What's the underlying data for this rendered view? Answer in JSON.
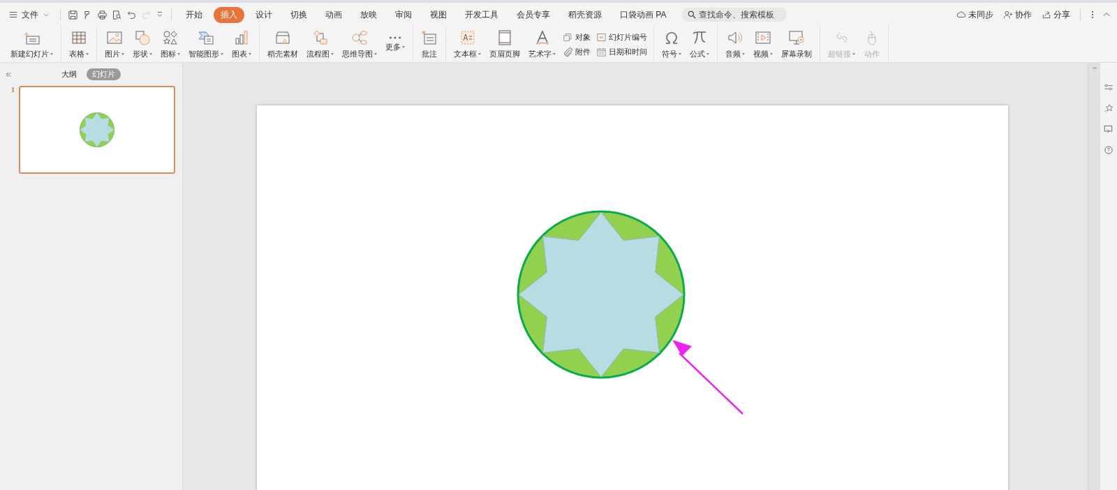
{
  "menu": {
    "file_label": "文件",
    "tabs": [
      {
        "label": "开始",
        "selected": false
      },
      {
        "label": "插入",
        "selected": true
      },
      {
        "label": "设计",
        "selected": false
      },
      {
        "label": "切换",
        "selected": false
      },
      {
        "label": "动画",
        "selected": false
      },
      {
        "label": "放映",
        "selected": false
      },
      {
        "label": "审阅",
        "selected": false
      },
      {
        "label": "视图",
        "selected": false
      },
      {
        "label": "开发工具",
        "selected": false
      },
      {
        "label": "会员专享",
        "selected": false
      },
      {
        "label": "稻壳资源",
        "selected": false
      },
      {
        "label": "口袋动画 PA",
        "selected": false
      }
    ],
    "search": {
      "placeholder": "查找命令、搜索模板"
    },
    "actions": [
      {
        "label": "未同步"
      },
      {
        "label": "协作"
      },
      {
        "label": "分享"
      }
    ]
  },
  "ribbon": {
    "groups": [
      {
        "items": [
          {
            "kind": "large",
            "label": "新建幻灯片",
            "dropdown": true,
            "disabled": false
          }
        ]
      },
      {
        "items": [
          {
            "kind": "large",
            "label": "表格",
            "dropdown": true,
            "disabled": false
          }
        ]
      },
      {
        "items": [
          {
            "kind": "large",
            "label": "图片",
            "dropdown": true,
            "disabled": false
          },
          {
            "kind": "large",
            "label": "形状",
            "dropdown": true,
            "disabled": false
          },
          {
            "kind": "large",
            "label": "图标",
            "dropdown": true,
            "disabled": false
          },
          {
            "kind": "large",
            "label": "智能图形",
            "dropdown": true,
            "disabled": false
          },
          {
            "kind": "large",
            "label": "图表",
            "dropdown": true,
            "disabled": false
          }
        ]
      },
      {
        "items": [
          {
            "kind": "large",
            "label": "稻壳素材",
            "dropdown": false,
            "disabled": false
          },
          {
            "kind": "large",
            "label": "流程图",
            "dropdown": true,
            "disabled": false
          },
          {
            "kind": "large",
            "label": "思维导图",
            "dropdown": true,
            "disabled": false
          },
          {
            "kind": "large",
            "label": "更多",
            "dropdown": true,
            "disabled": false
          }
        ]
      },
      {
        "items": [
          {
            "kind": "large",
            "label": "批注",
            "dropdown": false,
            "disabled": false
          }
        ]
      },
      {
        "items": [
          {
            "kind": "large",
            "label": "文本框",
            "dropdown": true,
            "disabled": false
          },
          {
            "kind": "large",
            "label": "页眉页脚",
            "dropdown": false,
            "disabled": false
          },
          {
            "kind": "large",
            "label": "艺术字",
            "dropdown": true,
            "disabled": false
          },
          {
            "kind": "small",
            "label": "对象",
            "dropdown": false,
            "disabled": false
          },
          {
            "kind": "small",
            "label": "附件",
            "dropdown": false,
            "disabled": false
          },
          {
            "kind": "small",
            "label": "幻灯片编号",
            "dropdown": false,
            "disabled": false
          },
          {
            "kind": "small",
            "label": "日期和时间",
            "dropdown": false,
            "disabled": false
          }
        ]
      },
      {
        "items": [
          {
            "kind": "large",
            "label": "符号",
            "dropdown": true,
            "disabled": false
          },
          {
            "kind": "large",
            "label": "公式",
            "dropdown": true,
            "disabled": false
          }
        ]
      },
      {
        "items": [
          {
            "kind": "large",
            "label": "音频",
            "dropdown": true,
            "disabled": false
          },
          {
            "kind": "large",
            "label": "视频",
            "dropdown": true,
            "disabled": false
          },
          {
            "kind": "large",
            "label": "屏幕录制",
            "dropdown": false,
            "disabled": false
          }
        ]
      },
      {
        "items": [
          {
            "kind": "large",
            "label": "超链接",
            "dropdown": true,
            "disabled": true
          },
          {
            "kind": "large",
            "label": "动作",
            "dropdown": false,
            "disabled": true
          }
        ]
      }
    ]
  },
  "sidebar": {
    "tabs": [
      {
        "label": "大纲",
        "selected": false
      },
      {
        "label": "幻灯片",
        "selected": true
      }
    ],
    "slides": [
      {
        "number": "1",
        "selected": true
      }
    ]
  }
}
